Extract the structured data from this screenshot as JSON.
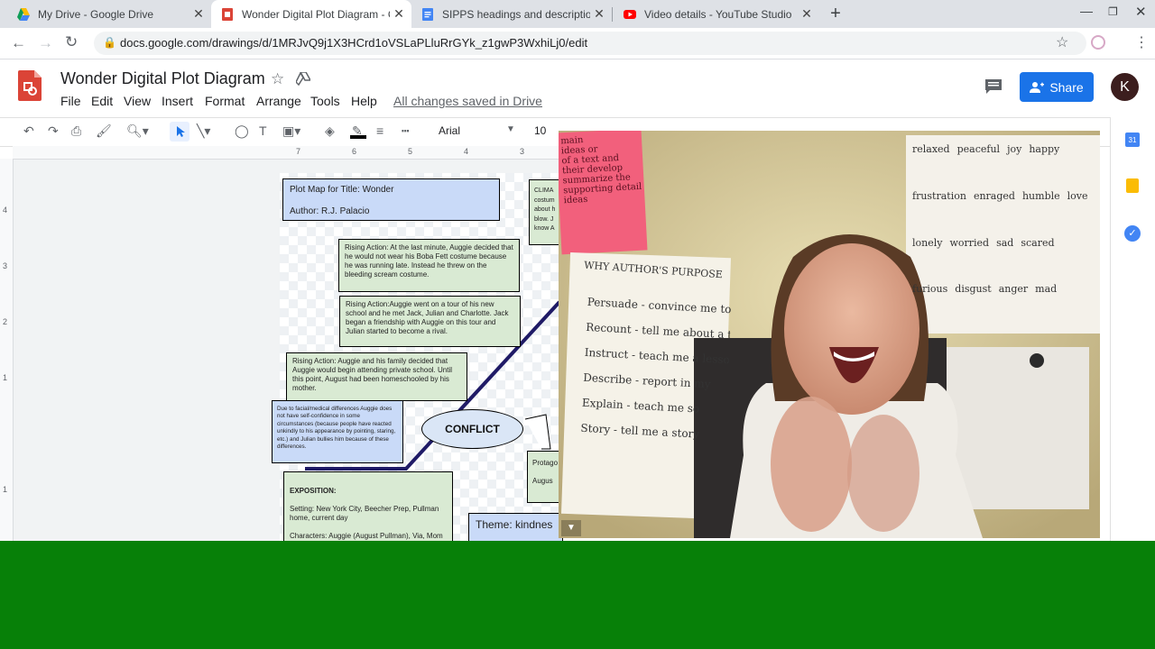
{
  "browser": {
    "tabs": [
      {
        "title": "My Drive - Google Drive",
        "active": false
      },
      {
        "title": "Wonder Digital Plot Diagram - Go",
        "active": true
      },
      {
        "title": "SIPPS headings and descriptions",
        "active": false
      },
      {
        "title": "Video details - YouTube Studio",
        "active": false
      }
    ],
    "new_tab": "+",
    "url": "docs.google.com/drawings/d/1MRJvQ9j1X3HCrd1oVSLaPLluRrGYk_z1gwP3WxhiLj0/edit",
    "profile_initial": "K"
  },
  "doc": {
    "title": "Wonder Digital Plot Diagram",
    "menu": [
      "File",
      "Edit",
      "View",
      "Insert",
      "Format",
      "Arrange",
      "Tools",
      "Help"
    ],
    "save_status": "All changes saved in Drive",
    "share_label": "Share",
    "avatar_initial": "K"
  },
  "toolbar": {
    "font": "Arial",
    "size": "10"
  },
  "ruler": {
    "top_marks": [
      "7",
      "6",
      "5",
      "4",
      "3"
    ],
    "left_marks": [
      "4",
      "3",
      "2",
      "1",
      "1"
    ]
  },
  "diagram": {
    "plot_map": "Plot Map for Title: Wonder\n\nAuthor: R.J. Palacio",
    "rising1": "Rising Action: At the last minute, Auggie decided that he would not wear his Boba Fett costume because he was running late.  Instead he threw on the bleeding scream costume.",
    "rising2": "Rising Action:Auggie went on a tour of his new school and he met Jack, Julian and Charlotte. Jack began a friendship with Auggie on this tour and Julian started to become a rival.",
    "rising3": "Rising Action: Auggie and his family decided that Auggie would begin attending private school.  Until this point, August had been homeschooled by his mother.",
    "due_to": "Due to facial/medical differences Auggie does not have self-confidence in some circumstances (because people have reacted unkindly to his appearance by pointing, staring, etc.) and Julian bullies him because of these differences.",
    "conflict": "CONFLICT",
    "climax_partial": "CLIMA\ncostum\nabout h\nblow. J\nknow A",
    "exposition_title": "EXPOSITION:",
    "exposition_body": "Setting: New York City, Beecher Prep, Pullman home, current day\n\nCharacters: Auggie (August Pullman), Via, Mom (Mrs. Pullman), Dad (Mr. Pullman),",
    "protag_partial": "Protago\n\nAugus",
    "theme": "Theme:  kindnes"
  },
  "webcam": {
    "poster_purpose": "WHY AUTHOR'S PURPOSE",
    "poster_lines": [
      "Persuade - convince me to believe something",
      "Recount - tell me about a true story, person or event",
      "Instruct - teach me a lesson",
      "Describe - report in my",
      "Explain - teach me so",
      "Story - tell me a story"
    ],
    "pink_note": "main\nideas or\nof a text and\ntheir develop\nsummarize the\nsupporting detail\nideas",
    "feelings_words": [
      "relaxed",
      "peaceful",
      "joy",
      "happy",
      "frustration",
      "enraged",
      "humble",
      "love",
      "lonely",
      "worried",
      "sad",
      "scared",
      "furious",
      "disgust",
      "anger",
      "mad"
    ]
  },
  "colors": {
    "green_bar": "#078008",
    "share_button": "#1a73e8",
    "plot_line": "#1f1a66"
  }
}
